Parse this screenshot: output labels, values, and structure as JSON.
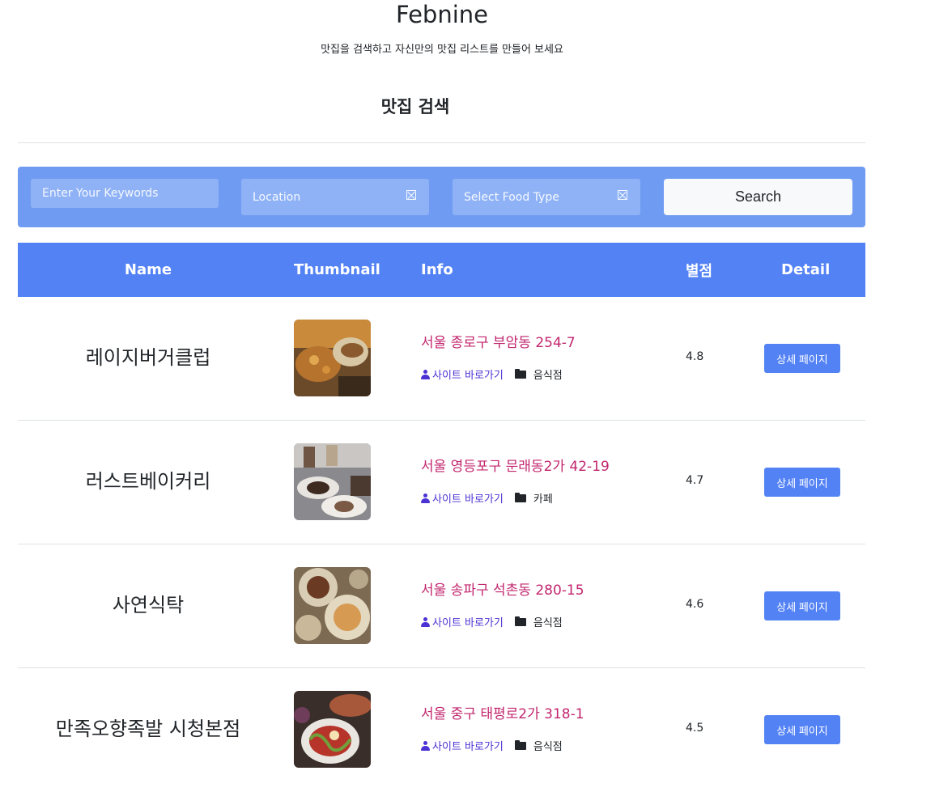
{
  "header": {
    "title": "Febnine",
    "subtitle": "맛집을 검색하고 자신만의 맛집 리스트를 만들어 보세요"
  },
  "search": {
    "section_title": "맛집 검색",
    "keyword_placeholder": "Enter Your Keywords",
    "location_placeholder": "Location",
    "food_type_placeholder": "Select Food Type",
    "button_label": "Search"
  },
  "table": {
    "headers": {
      "name": "Name",
      "thumbnail": "Thumbnail",
      "info": "Info",
      "rating": "별점",
      "detail": "Detail"
    },
    "rows": [
      {
        "name": "레이지버거클럽",
        "address": "서울 종로구 부암동 254-7",
        "site_link": "사이트 바로가기",
        "category": "음식점",
        "rating": "4.8",
        "detail_label": "상세 페이지"
      },
      {
        "name": "러스트베이커리",
        "address": "서울 영등포구 문래동2가 42-19",
        "site_link": "사이트 바로가기",
        "category": "카페",
        "rating": "4.7",
        "detail_label": "상세 페이지"
      },
      {
        "name": "사연식탁",
        "address": "서울 송파구 석촌동 280-15",
        "site_link": "사이트 바로가기",
        "category": "음식점",
        "rating": "4.6",
        "detail_label": "상세 페이지"
      },
      {
        "name": "만족오향족발 시청본점",
        "address": "서울 중구 태평로2가 318-1",
        "site_link": "사이트 바로가기",
        "category": "음식점",
        "rating": "4.5",
        "detail_label": "상세 페이지"
      }
    ]
  },
  "colors": {
    "accent": "#5382f5",
    "search_panel": "#6f9bf2",
    "address": "#c2266e",
    "link": "#4b32d3"
  }
}
